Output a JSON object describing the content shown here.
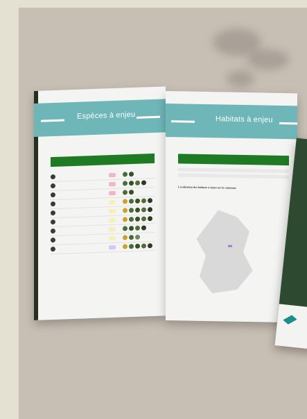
{
  "left_page": {
    "banner_title": "Espèces à enjeu",
    "rows": [
      {
        "pill_color": "#f2b6c9",
        "dots": [
          "#4a6b3a",
          "#365028"
        ]
      },
      {
        "pill_color": "#f2b6c9",
        "dots": [
          "#4a6b3a",
          "#365028",
          "#556b3a",
          "#2c3a28"
        ]
      },
      {
        "pill_color": "#f2b6c9",
        "dots": [
          "#4a6b3a",
          "#365028"
        ]
      },
      {
        "pill_color": "#f4f0b8",
        "dots": [
          "#caa22a",
          "#4a6b3a",
          "#365028",
          "#556b3a",
          "#2c3a28"
        ]
      },
      {
        "pill_color": "#f4f0b8",
        "dots": [
          "#caa22a",
          "#4a6b3a",
          "#365028",
          "#556b3a",
          "#2c3a28"
        ]
      },
      {
        "pill_color": "#f4f0b8",
        "dots": [
          "#caa22a",
          "#4a6b3a",
          "#365028",
          "#556b3a",
          "#2c3a28"
        ]
      },
      {
        "pill_color": "#f4f0b8",
        "dots": [
          "#4a6b3a",
          "#365028",
          "#556b3a",
          "#2c3a28"
        ]
      },
      {
        "pill_color": "#f4f0b8",
        "dots": [
          "#caa22a",
          "#4a6b3a",
          "#6c8a5a"
        ]
      },
      {
        "pill_color": "#d6c8f2",
        "dots": [
          "#caa22a",
          "#4a6b3a",
          "#365028",
          "#556b3a",
          "#2c3a28"
        ]
      }
    ]
  },
  "right_page": {
    "banner_title": "Habitats à enjeu",
    "map_title": "Localisation des habitats à enjeu sur la commune"
  },
  "colors": {
    "teal": "#6fb6b9",
    "green": "#1f7a24",
    "background": "#c8bfb4"
  }
}
